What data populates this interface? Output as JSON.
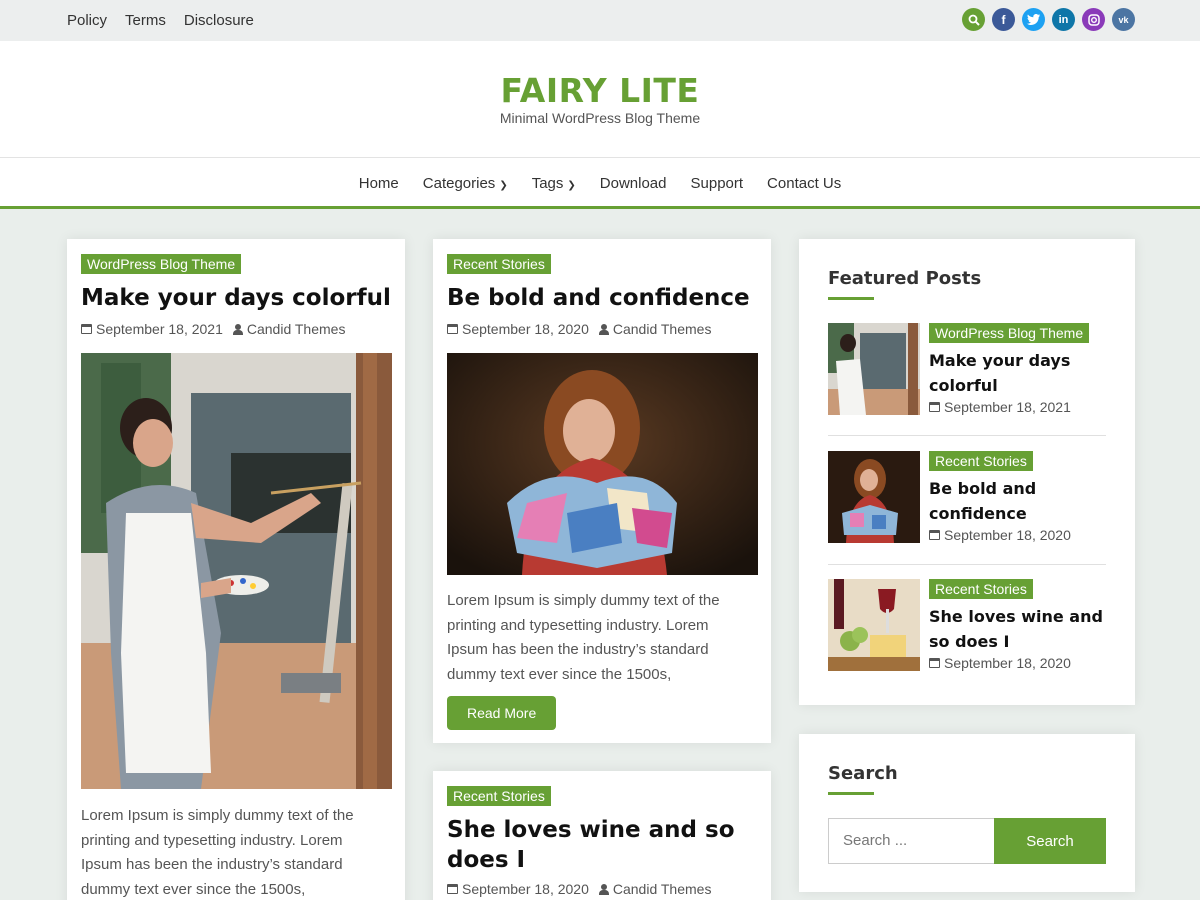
{
  "topbar": {
    "links": [
      "Policy",
      "Terms",
      "Disclosure"
    ],
    "icons": [
      {
        "name": "search-icon",
        "glyph": "⌕",
        "color": "#67a034"
      },
      {
        "name": "facebook-icon",
        "glyph": "f",
        "color": "#3b5998"
      },
      {
        "name": "twitter-icon",
        "glyph": "t",
        "color": "#1da1f2"
      },
      {
        "name": "linkedin-icon",
        "glyph": "in",
        "color": "#0e76a8"
      },
      {
        "name": "instagram-icon",
        "glyph": "◎",
        "color": "#8a3ab9"
      },
      {
        "name": "vk-icon",
        "glyph": "vk",
        "color": "#4c75a3"
      }
    ]
  },
  "site": {
    "title": "FAIRY LITE",
    "description": "Minimal WordPress Blog Theme"
  },
  "nav": {
    "items": [
      "Home",
      "Categories",
      "Tags",
      "Download",
      "Support",
      "Contact Us"
    ]
  },
  "posts": [
    {
      "category": "WordPress Blog Theme",
      "title": "Make your days colorful",
      "date": "September 18, 2021",
      "author": "Candid Themes",
      "excerpt": "Lorem Ipsum is simply dummy text of the printing and typesetting industry. Lorem Ipsum has been the industry’s standard dummy text ever since the 1500s,"
    },
    {
      "category": "Recent Stories",
      "title": "Be bold and confidence",
      "date": "September 18, 2020",
      "author": "Candid Themes",
      "excerpt": "Lorem Ipsum is simply dummy text of the printing and typesetting industry. Lorem Ipsum has been the industry’s standard dummy text ever since the 1500s,",
      "read_more": "Read More"
    },
    {
      "category": "Recent Stories",
      "title": "She loves wine and so does I",
      "date": "September 18, 2020",
      "author": "Candid Themes"
    }
  ],
  "sidebar": {
    "featured_title": "Featured Posts",
    "featured": [
      {
        "category": "WordPress Blog Theme",
        "title": "Make your days colorful",
        "date": "September 18, 2021"
      },
      {
        "category": "Recent Stories",
        "title": "Be bold and confidence",
        "date": "September 18, 2020"
      },
      {
        "category": "Recent Stories",
        "title": "She loves wine and so does I",
        "date": "September 18, 2020"
      }
    ],
    "search_title": "Search",
    "search_placeholder": "Search ...",
    "search_button": "Search"
  },
  "colors": {
    "accent": "#67a034"
  }
}
